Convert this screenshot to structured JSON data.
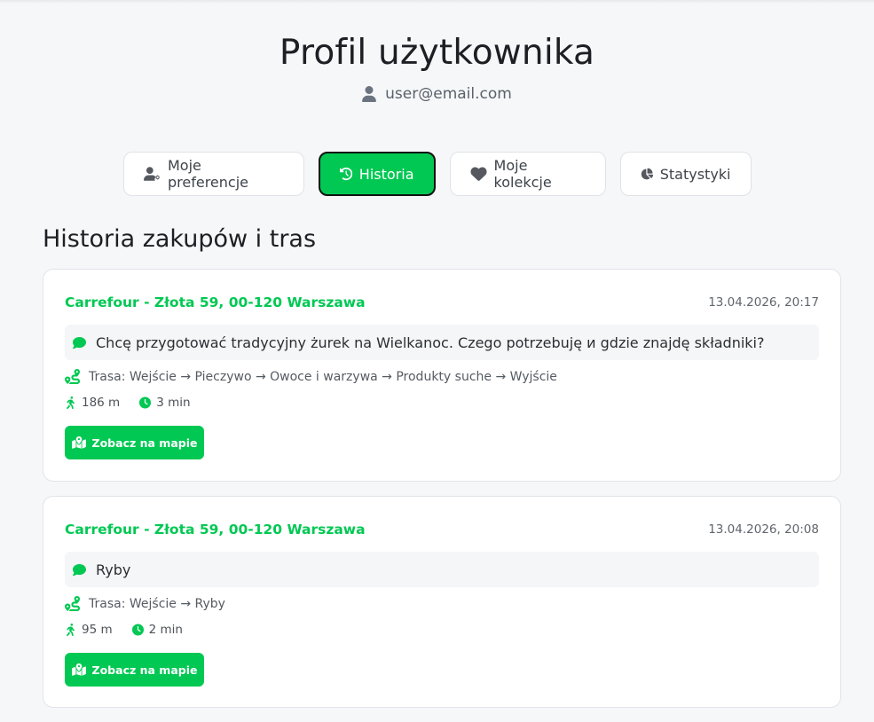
{
  "header": {
    "title": "Profil użytkownika",
    "email": "user@email.com",
    "user_icon": "user-icon"
  },
  "tabs": [
    {
      "label": "Moje preferencje",
      "icon": "user-gear-icon",
      "active": false
    },
    {
      "label": "Historia",
      "icon": "history-icon",
      "active": true
    },
    {
      "label": "Moje kolekcje",
      "icon": "heart-icon",
      "active": false
    },
    {
      "label": "Statystyki",
      "icon": "pie-chart-icon",
      "active": false
    }
  ],
  "section_title": "Historia zakupów i tras",
  "history": [
    {
      "store": "Carrefour - Złota 59, 00-120 Warszawa",
      "date": "13.04.2026, 20:17",
      "query": "Chcę przygotować tradycyjny żurek na Wielkanoc. Czego potrzebuję и gdzie znajdę składniki?",
      "route": "Trasa: Wejście → Pieczywo → Owoce i warzywa → Produkty suche → Wyjście",
      "distance": "186 m",
      "duration": "3 min",
      "button_label": "Zobacz na mapie"
    },
    {
      "store": "Carrefour - Złota 59, 00-120 Warszawa",
      "date": "13.04.2026, 20:08",
      "query": "Ryby",
      "route": "Trasa: Wejście → Ryby",
      "distance": "95 m",
      "duration": "2 min",
      "button_label": "Zobacz na mapie"
    }
  ],
  "colors": {
    "accent": "#00c853",
    "background": "#f6f7f9",
    "card": "#ffffff"
  }
}
